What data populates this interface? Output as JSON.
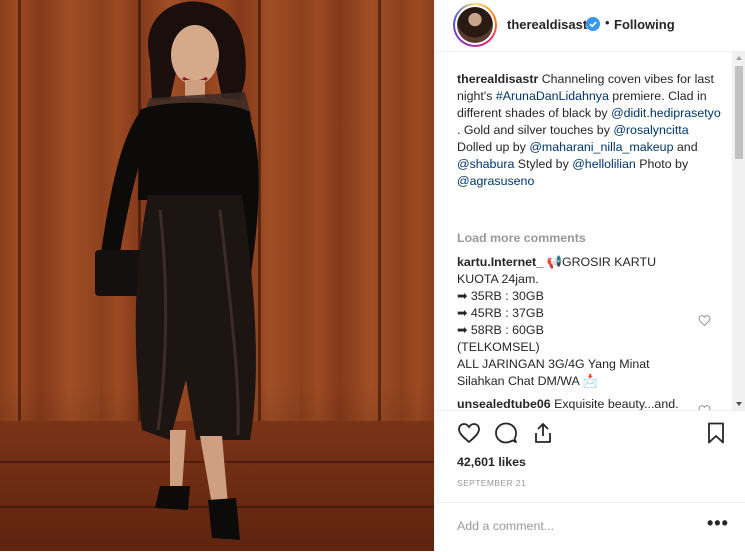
{
  "post": {
    "username": "therealdisastr",
    "follow_status": "Following",
    "separator": "•"
  },
  "caption": {
    "username": "therealdisastr",
    "text_1": " Channeling coven vibes for last night's ",
    "hashtag": "#ArunaDanLidahnya",
    "text_2": " premiere. Clad in different shades of black by ",
    "mention_1": "@didit.hediprasetyo",
    "text_3": " . Gold and silver touches by ",
    "mention_2": "@rosalyncitta",
    "text_4": " Dolled up by ",
    "mention_3": "@maharani_nilla_makeup",
    "text_5": " and ",
    "mention_4": "@shabura",
    "text_6": " Styled by ",
    "mention_5": "@hellolilian",
    "text_7": " Photo by ",
    "mention_6": "@agrasuseno"
  },
  "load_more": "Load more comments",
  "comments": [
    {
      "username": "kartu.Internet_",
      "lines": [
        "📢GROSIR KARTU KUOTA 24jam.",
        "➡ 35RB : 30GB",
        "➡ 45RB : 37GB",
        "➡ 58RB : 60GB",
        "(TELKOMSEL)",
        "ALL JARINGAN 3G/4G Yang Minat Silahkan Chat DM/WA 📩"
      ]
    },
    {
      "username": "unsealedtube06",
      "text": " Exquisite beauty...and."
    }
  ],
  "likes": "42,601 likes",
  "date": "SEPTEMBER 21",
  "add_comment_placeholder": "Add a comment...",
  "more_label": "•••",
  "colors": {
    "link": "#003569",
    "muted": "#999999",
    "text": "#262626",
    "verified": "#3897f0",
    "wall": "#94461f"
  },
  "icons": {
    "like": "heart-icon",
    "comment": "comment-icon",
    "share": "share-icon",
    "save": "bookmark-icon",
    "verified": "verified-badge-icon",
    "small_like": "heart-icon"
  }
}
